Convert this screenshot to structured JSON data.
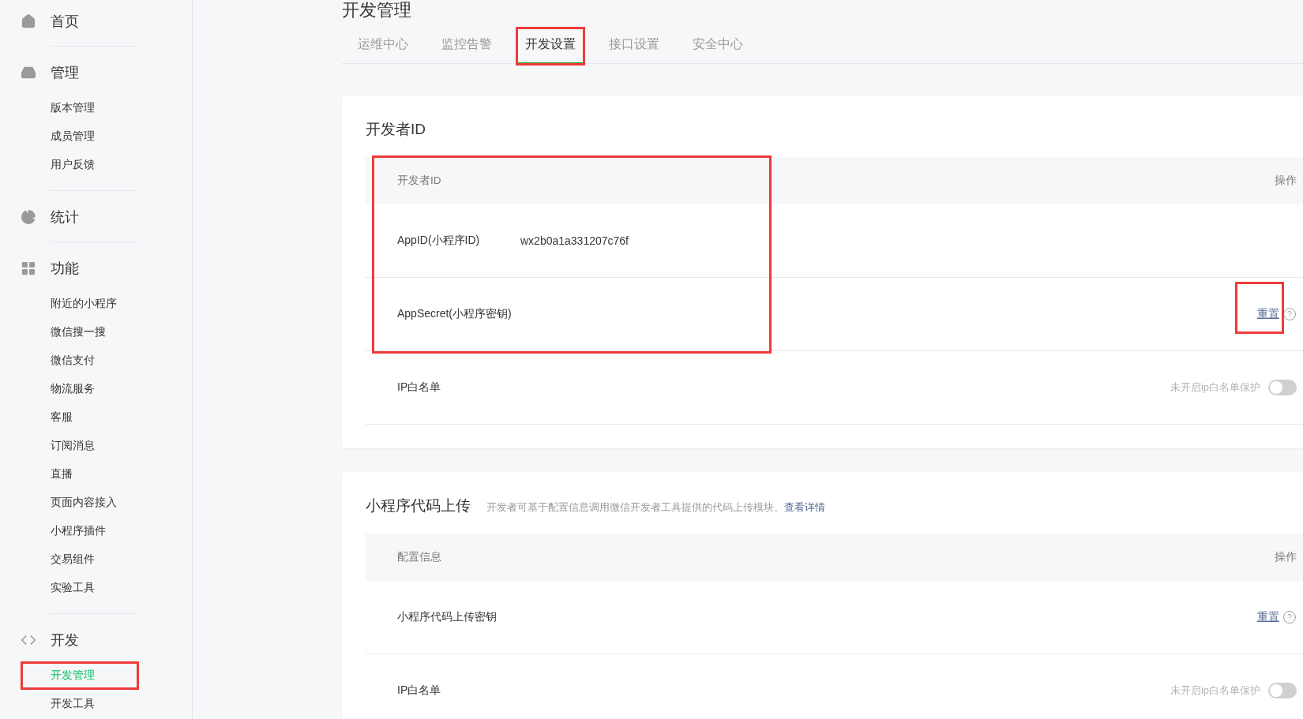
{
  "sidebar": {
    "groups": [
      {
        "kind": "home",
        "label": "首页"
      },
      {
        "kind": "inbox",
        "label": "管理",
        "items": [
          {
            "label": "版本管理",
            "selected": false,
            "highlighted": false
          },
          {
            "label": "成员管理",
            "selected": false,
            "highlighted": false
          },
          {
            "label": "用户反馈",
            "selected": false,
            "highlighted": false
          }
        ]
      },
      {
        "kind": "pie",
        "label": "统计"
      },
      {
        "kind": "grid",
        "label": "功能",
        "items": [
          {
            "label": "附近的小程序",
            "selected": false,
            "highlighted": false
          },
          {
            "label": "微信搜一搜",
            "selected": false,
            "highlighted": false
          },
          {
            "label": "微信支付",
            "selected": false,
            "highlighted": false
          },
          {
            "label": "物流服务",
            "selected": false,
            "highlighted": false
          },
          {
            "label": "客服",
            "selected": false,
            "highlighted": false
          },
          {
            "label": "订阅消息",
            "selected": false,
            "highlighted": false
          },
          {
            "label": "直播",
            "selected": false,
            "highlighted": false
          },
          {
            "label": "页面内容接入",
            "selected": false,
            "highlighted": false
          },
          {
            "label": "小程序插件",
            "selected": false,
            "highlighted": false
          },
          {
            "label": "交易组件",
            "selected": false,
            "highlighted": false
          },
          {
            "label": "实验工具",
            "selected": false,
            "highlighted": false
          }
        ]
      },
      {
        "kind": "code",
        "label": "开发",
        "items": [
          {
            "label": "开发管理",
            "selected": true,
            "highlighted": true
          },
          {
            "label": "开发工具",
            "selected": false,
            "highlighted": false
          }
        ]
      }
    ]
  },
  "page_title": "开发管理",
  "tabs": [
    {
      "label": "运维中心",
      "selected": false,
      "highlighted": false
    },
    {
      "label": "监控告警",
      "selected": false,
      "highlighted": false
    },
    {
      "label": "开发设置",
      "selected": true,
      "highlighted": true
    },
    {
      "label": "接口设置",
      "selected": false,
      "highlighted": false
    },
    {
      "label": "安全中心",
      "selected": false,
      "highlighted": false
    }
  ],
  "sections": [
    {
      "title": "开发者ID",
      "table": {
        "highlighted": true,
        "columns": [
          "开发者ID",
          "操作"
        ],
        "rows": [
          {
            "kind": "value",
            "label": "AppID(小程序ID)",
            "value": "wx2b0a1a331207c76f"
          },
          {
            "kind": "action",
            "label": "AppSecret(小程序密钥)",
            "action": "重置",
            "highlighted": true
          },
          {
            "kind": "toggle",
            "label": "IP白名单",
            "status": "未开启ip白名单保护",
            "on": false
          }
        ]
      }
    },
    {
      "title": "小程序代码上传",
      "description": "开发者可基于配置信息调用微信开发者工具提供的代码上传模块。",
      "link": "查看详情",
      "table": {
        "columns": [
          "配置信息",
          "操作"
        ],
        "rows": [
          {
            "kind": "action",
            "label": "小程序代码上传密钥",
            "action": "重置"
          },
          {
            "kind": "toggle",
            "label": "IP白名单",
            "status": "未开启ip白名单保护",
            "on": false
          }
        ]
      }
    }
  ]
}
